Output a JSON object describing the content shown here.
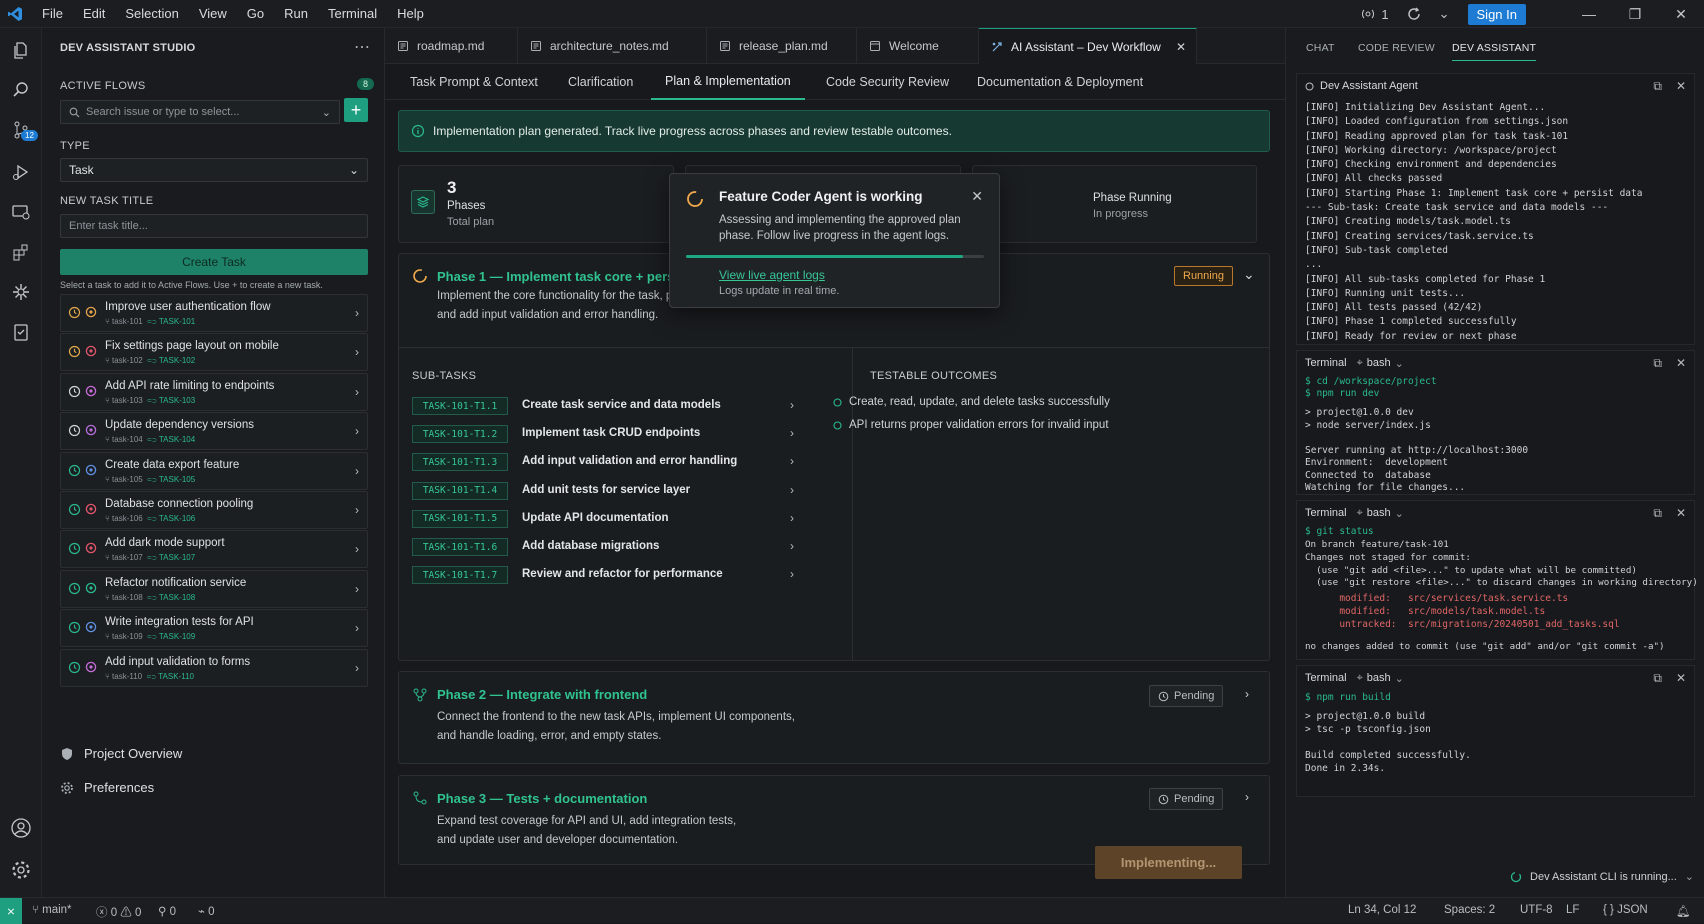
{
  "menu": [
    "File",
    "Edit",
    "Selection",
    "View",
    "Go",
    "Run",
    "Terminal",
    "Help"
  ],
  "titlebar": {
    "ports_count": "1",
    "sign_in": "Sign In"
  },
  "activity": {
    "source_control_badge": "12"
  },
  "sidebar": {
    "title": "DEV ASSISTANT STUDIO",
    "active_flows_label": "ACTIVE FLOWS",
    "active_flows_count": "8",
    "search_placeholder": "Search issue or type to select...",
    "type_label": "TYPE",
    "type_value": "Task",
    "new_task_label": "NEW TASK TITLE",
    "new_task_placeholder": "Enter task title...",
    "create_button": "Create Task",
    "hint": "Select a task to add it to Active Flows. Use + to create a new task.",
    "tasks": [
      {
        "title": "Improve user authentication flow",
        "id": "task-101",
        "ref": "TASK-101"
      },
      {
        "title": "Fix settings page layout on mobile",
        "id": "task-102",
        "ref": "TASK-102"
      },
      {
        "title": "Add API rate limiting to endpoints",
        "id": "task-103",
        "ref": "TASK-103"
      },
      {
        "title": "Update dependency versions",
        "id": "task-104",
        "ref": "TASK-104"
      },
      {
        "title": "Create data export feature",
        "id": "task-105",
        "ref": "TASK-105"
      },
      {
        "title": "Database connection pooling",
        "id": "task-106",
        "ref": "TASK-106"
      },
      {
        "title": "Add dark mode support",
        "id": "task-107",
        "ref": "TASK-107"
      },
      {
        "title": "Refactor notification service",
        "id": "task-108",
        "ref": "TASK-108"
      },
      {
        "title": "Write integration tests for API",
        "id": "task-109",
        "ref": "TASK-109"
      },
      {
        "title": "Add input validation to forms",
        "id": "task-110",
        "ref": "TASK-110"
      }
    ],
    "project_overview": "Project Overview",
    "preferences": "Preferences"
  },
  "editor": {
    "tabs": [
      "roadmap.md",
      "architecture_notes.md",
      "release_plan.md",
      "Welcome",
      "AI Assistant – Dev Workflow"
    ],
    "subtabs": [
      "Task Prompt & Context",
      "Clarification",
      "Plan & Implementation",
      "Code Security Review",
      "Documentation & Deployment"
    ],
    "banner": "Implementation plan generated. Track live progress across phases and review testable outcomes.",
    "stats": [
      {
        "number": "3",
        "label": "Phases",
        "sub": "Total plan"
      },
      {
        "label": "Phase Running",
        "sub": "In progress"
      }
    ],
    "phase1": {
      "title": "Phase 1 — Implement task core + persist data",
      "desc1": "Implement the core functionality for the task, persist ch",
      "desc2": "and add input validation and error handling.",
      "status": "Running",
      "subtasks_label": "SUB-TASKS",
      "outcomes_label": "TESTABLE OUTCOMES",
      "subtasks": [
        {
          "code": "TASK-101-T1.1",
          "name": "Create task service and data models"
        },
        {
          "code": "TASK-101-T1.2",
          "name": "Implement task CRUD endpoints"
        },
        {
          "code": "TASK-101-T1.3",
          "name": "Add input validation and error handling"
        },
        {
          "code": "TASK-101-T1.4",
          "name": "Add unit tests for service layer"
        },
        {
          "code": "TASK-101-T1.5",
          "name": "Update API documentation"
        },
        {
          "code": "TASK-101-T1.6",
          "name": "Add database migrations"
        },
        {
          "code": "TASK-101-T1.7",
          "name": "Review and refactor for performance"
        }
      ],
      "outcomes": [
        "Create, read, update, and delete tasks successfully",
        "API returns proper validation errors for invalid input"
      ]
    },
    "phase2": {
      "title": "Phase 2 — Integrate with frontend",
      "desc1": "Connect the frontend to the new task APIs, implement UI components,",
      "desc2": "and handle loading, error, and empty states.",
      "status": "Pending"
    },
    "phase3": {
      "title": "Phase 3 — Tests + documentation",
      "desc1": "Expand test coverage for API and UI, add integration tests,",
      "desc2": "and update user and developer documentation.",
      "status": "Pending"
    },
    "popup": {
      "title": "Feature Coder Agent is working",
      "desc": "Assessing and implementing the approved plan phase. Follow live progress in the agent logs.",
      "progress": 0.93,
      "link": "View live agent logs",
      "sub": "Logs update in real time."
    },
    "implementing_button": "Implementing..."
  },
  "right": {
    "tabs": [
      "CHAT",
      "CODE REVIEW",
      "DEV ASSISTANT"
    ],
    "agent_title": "Dev Assistant Agent",
    "agent_log": "[INFO] Initializing Dev Assistant Agent...\n[INFO] Loaded configuration from settings.json\n[INFO] Reading approved plan for task task-101\n[INFO] Working directory: /workspace/project\n[INFO] Checking environment and dependencies\n[INFO] All checks passed\n[INFO] Starting Phase 1: Implement task core + persist data\n--- Sub-task: Create task service and data models ---\n[INFO] Creating models/task.model.ts\n[INFO] Creating services/task.service.ts\n[INFO] Sub-task completed\n...\n[INFO] All sub-tasks completed for Phase 1\n[INFO] Running unit tests...\n[INFO] All tests passed (42/42)\n[INFO] Phase 1 completed successfully\n[INFO] Ready for review or next phase",
    "terminal_label": "Terminal",
    "shell_label": "bash",
    "term1": {
      "cmd1": "$ cd /workspace/project",
      "cmd2": "$ npm run dev",
      "out": "> project@1.0.0 dev\n> node server/index.js\n\nServer running at http://localhost:3000\nEnvironment:  development\nConnected to  database\nWatching for file changes..."
    },
    "term2": {
      "cmd": "$ git status",
      "out": "On branch feature/task-101\nChanges not staged for commit:\n  (use \"git add <file>...\" to update what will be committed)\n  (use \"git restore <file>...\" to discard changes in working directory)",
      "changes": "      modified:   src/services/task.service.ts\n      modified:   src/models/task.model.ts\n      untracked:  src/migrations/20240501_add_tasks.sql",
      "tail": "no changes added to commit (use \"git add\" and/or \"git commit -a\")"
    },
    "term3": {
      "cmd": "$ npm run build",
      "out": "> project@1.0.0 build\n> tsc -p tsconfig.json\n\nBuild completed successfully.\nDone in 2.34s."
    },
    "cli_status": "Dev Assistant CLI is running..."
  },
  "statusbar": {
    "branch": "main*",
    "problems": "0 ⚠ 0",
    "ports": "0",
    "sync": "0",
    "cursor": "Ln 34, Col 12",
    "spaces": "Spaces: 2",
    "encoding": "UTF-8",
    "eol": "LF",
    "language": "{ } JSON"
  }
}
